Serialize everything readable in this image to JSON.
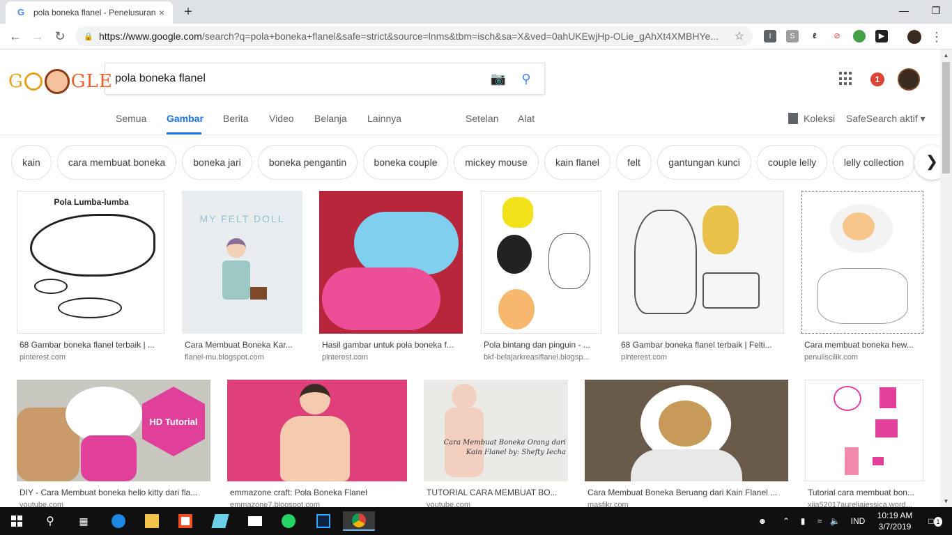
{
  "browser": {
    "tab_title": "pola boneka flanel - Penelusuran Google",
    "tab_close": "×",
    "new_tab": "+",
    "url_domain": "https://www.google.com",
    "url_rest": "/search?q=pola+boneka+flanel&safe=strict&source=lnms&tbm=isch&sa=X&ved=0ahUKEwjHp-OLie_gAhXt4XMBHYe...",
    "minimize": "—",
    "maximize": "❐",
    "close": "✕"
  },
  "google": {
    "logo_left": "G",
    "logo_right": "GLE",
    "query": "pola boneka flanel",
    "notifications": "1"
  },
  "nav": {
    "tabs": [
      "Semua",
      "Gambar",
      "Berita",
      "Video",
      "Belanja",
      "Lainnya"
    ],
    "settings": "Setelan",
    "tools": "Alat",
    "collections": "Koleksi",
    "safesearch": "SafeSearch aktif ▾"
  },
  "chips": [
    "kain",
    "cara membuat boneka",
    "boneka jari",
    "boneka pengantin",
    "boneka couple",
    "mickey mouse",
    "kain flanel",
    "felt",
    "gantungan kunci",
    "couple lelly",
    "lelly collection"
  ],
  "results_row1": [
    {
      "title": "68 Gambar boneka flanel terbaik | ...",
      "source": "pinterest.com",
      "thumb_text": "Pola Lumba-lumba"
    },
    {
      "title": "Cara Membuat Boneka Kar...",
      "source": "flanel-mu.blogspot.com",
      "thumb_text": "MY FELT DOLL"
    },
    {
      "title": "Hasil gambar untuk pola boneka f...",
      "source": "pinterest.com",
      "thumb_text": ""
    },
    {
      "title": "Pola bintang dan pinguin - ...",
      "source": "bkf-belajarkreasiflanel.blogsp...",
      "thumb_text": ""
    },
    {
      "title": "68 Gambar boneka flanel terbaik | Felti...",
      "source": "pinterest.com",
      "thumb_text": ""
    },
    {
      "title": "Cara membuat boneka hew...",
      "source": "penuliscilik.com",
      "thumb_text": ""
    }
  ],
  "results_row2": [
    {
      "title": "DIY - Cara Membuat boneka hello kitty dari fla...",
      "source": "youtube.com",
      "thumb_text": "HD Tutorial"
    },
    {
      "title": "emmazone craft: Pola Boneka Flanel",
      "source": "emmazone7.blogspot.com",
      "thumb_text": ""
    },
    {
      "title": "TUTORIAL CARA MEMBUAT BO...",
      "source": "youtube.com",
      "thumb_text": "Cara Membuat Boneka Orang dari Kain Flanel by: Shefty Iecha"
    },
    {
      "title": "Cara Membuat Boneka Beruang dari Kain Flanel ...",
      "source": "masfikr.com",
      "thumb_text": ""
    },
    {
      "title": "Tutorial cara membuat bon...",
      "source": "xiia52017aureliajessica.word...",
      "thumb_text": ""
    }
  ],
  "taskbar": {
    "lang": "IND",
    "time": "10:19 AM",
    "date": "3/7/2019",
    "notif_count": "1"
  }
}
